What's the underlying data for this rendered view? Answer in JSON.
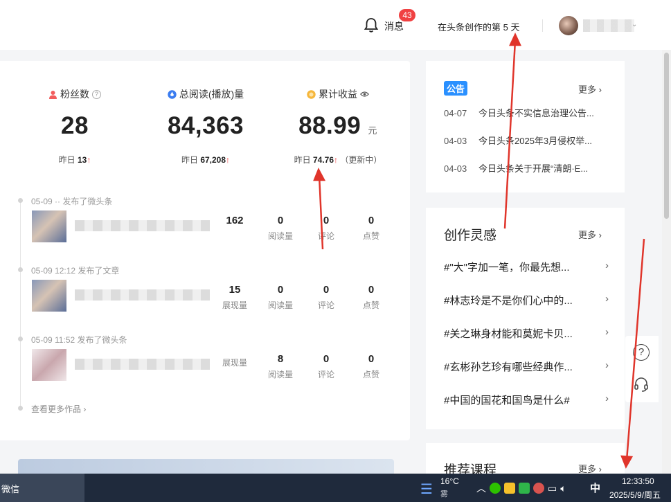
{
  "header": {
    "messages_label": "消息",
    "messages_badge": "43",
    "days_text": "在头条创作的第 5 天"
  },
  "stats": [
    {
      "label": "粉丝数",
      "value": "28",
      "unit": "",
      "sub_label": "昨日",
      "sub_value": "13",
      "sub_extra": "",
      "icon": "person-icon",
      "icon_color": "#f25c5c"
    },
    {
      "label": "总阅读(播放)量",
      "value": "84,363",
      "unit": "",
      "sub_label": "昨日",
      "sub_value": "67,208",
      "sub_extra": "",
      "icon": "drop-icon",
      "icon_color": "#3a7cf0"
    },
    {
      "label": "累计收益",
      "value": "88.99",
      "unit": "元",
      "sub_label": "昨日",
      "sub_value": "74.76",
      "sub_extra": "（更新中）",
      "icon": "coin-icon",
      "icon_color": "#f6b73c"
    }
  ],
  "works": [
    {
      "meta": "05-09 ·· 发布了微头条",
      "metrics": [
        {
          "value": "162",
          "label": ""
        },
        {
          "value": "0",
          "label": "阅读量"
        },
        {
          "value": "0",
          "label": "评论"
        },
        {
          "value": "0",
          "label": "点赞"
        }
      ]
    },
    {
      "meta": "05-09 12:12  发布了文章",
      "metrics": [
        {
          "value": "15",
          "label": "展现量"
        },
        {
          "value": "0",
          "label": "阅读量"
        },
        {
          "value": "0",
          "label": "评论"
        },
        {
          "value": "0",
          "label": "点赞"
        }
      ]
    },
    {
      "meta": "05-09 11:52  发布了微头条",
      "metrics": [
        {
          "value": "",
          "label": "展现量"
        },
        {
          "value": "8",
          "label": "阅读量"
        },
        {
          "value": "0",
          "label": "评论"
        },
        {
          "value": "0",
          "label": "点赞"
        }
      ]
    }
  ],
  "more_works": "查看更多作品 ›",
  "notice": {
    "tag": "公告",
    "more": "更多 ›",
    "items": [
      {
        "date": "04-07",
        "text": "今日头条不实信息治理公告..."
      },
      {
        "date": "04-03",
        "text": "今日头条2025年3月侵权举..."
      },
      {
        "date": "04-03",
        "text": "今日头条关于开展“清朗·E..."
      }
    ]
  },
  "inspiration": {
    "title": "创作灵感",
    "more": "更多 ›",
    "items": [
      "#\"大\"字加一笔，你最先想...",
      "#林志玲是不是你们心中的...",
      "#关之琳身材能和莫妮卡贝...",
      "#玄彬孙艺珍有哪些经典作...",
      "#中国的国花和国鸟是什么#"
    ]
  },
  "courses": {
    "title": "推荐课程",
    "more": "更多 ›"
  },
  "float": {
    "help": "?"
  },
  "taskbar": {
    "app": "微信",
    "weather_temp": "16°C",
    "weather_desc": "雾",
    "ime": "中",
    "time": "12:33:50",
    "date": "2025/5/9/周五"
  },
  "colors": {
    "accent": "#f04142",
    "notice_tag": "#2a90ff",
    "taskbar": "#1f2a3c"
  }
}
